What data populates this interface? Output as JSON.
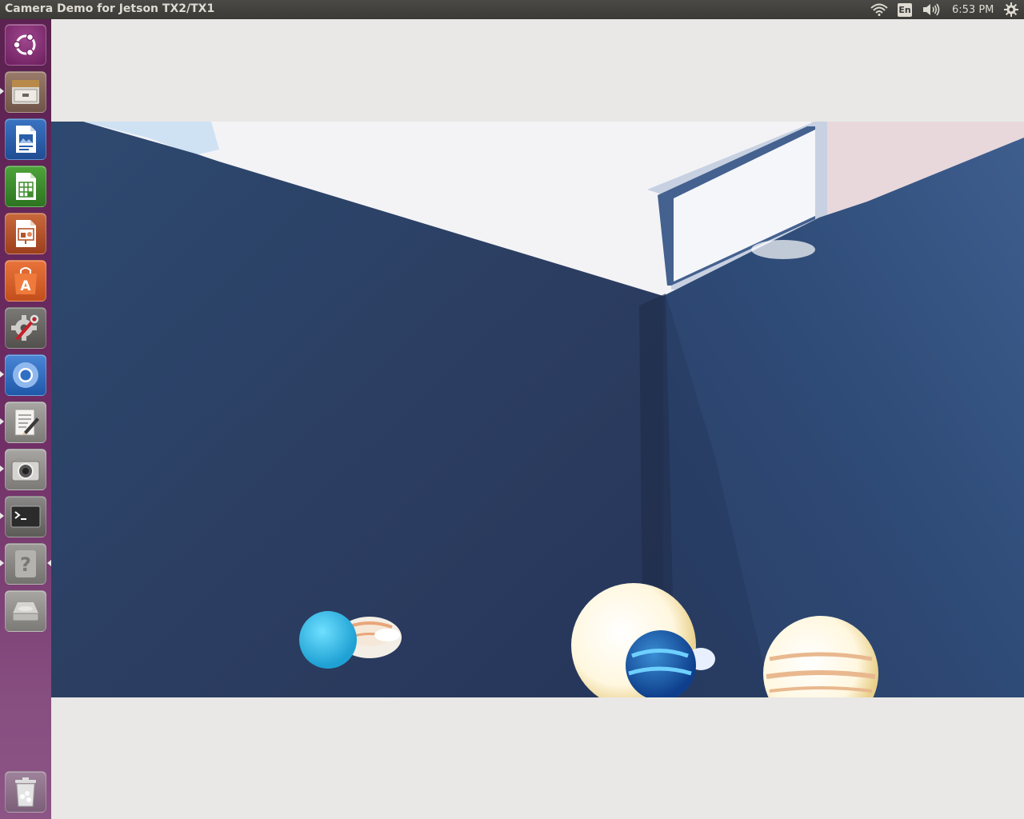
{
  "window": {
    "title": "Camera Demo for Jetson TX2/TX1"
  },
  "top_panel": {
    "keyboard_layout": "En",
    "clock": "6:53 PM",
    "indicators": [
      "wifi-icon",
      "keyboard-layout",
      "volume-icon",
      "session-gear-icon"
    ]
  },
  "launcher": {
    "items": [
      {
        "name": "ubuntu-dash",
        "icon": "ubuntu-logo-icon",
        "bg": "#7a2a6b",
        "running": false
      },
      {
        "name": "files",
        "icon": "file-cabinet-icon",
        "bg": "#8a6a5c",
        "running": true
      },
      {
        "name": "libreoffice-writer",
        "icon": "writer-document-icon",
        "bg": "#2a5ea8",
        "running": false
      },
      {
        "name": "libreoffice-calc",
        "icon": "calc-spreadsheet-icon",
        "bg": "#3f8d2b",
        "running": false
      },
      {
        "name": "libreoffice-impress",
        "icon": "impress-presentation-icon",
        "bg": "#b8532a",
        "running": false
      },
      {
        "name": "ubuntu-software",
        "icon": "software-bag-icon",
        "bg": "#d9602a",
        "running": false
      },
      {
        "name": "system-settings",
        "icon": "settings-gear-wrench-icon",
        "bg": "#6d6b68",
        "running": false
      },
      {
        "name": "chromium",
        "icon": "chromium-icon",
        "bg": "#2f6fc4",
        "running": true
      },
      {
        "name": "text-editor",
        "icon": "text-editor-icon",
        "bg": "#8d8b88",
        "running": true
      },
      {
        "name": "camera-app",
        "icon": "camera-icon",
        "bg": "#8d8b88",
        "running": true
      },
      {
        "name": "terminal",
        "icon": "terminal-icon",
        "bg": "#6a6966",
        "running": true
      },
      {
        "name": "help",
        "icon": "help-question-icon",
        "bg": "#8a8886",
        "running": true
      },
      {
        "name": "disk",
        "icon": "hard-disk-icon",
        "bg": "#8d8b88",
        "running": false
      }
    ],
    "trash": {
      "name": "trash",
      "icon": "trash-can-icon",
      "bg": "#8c6f89"
    }
  },
  "camera": {
    "description_hidden": true
  }
}
